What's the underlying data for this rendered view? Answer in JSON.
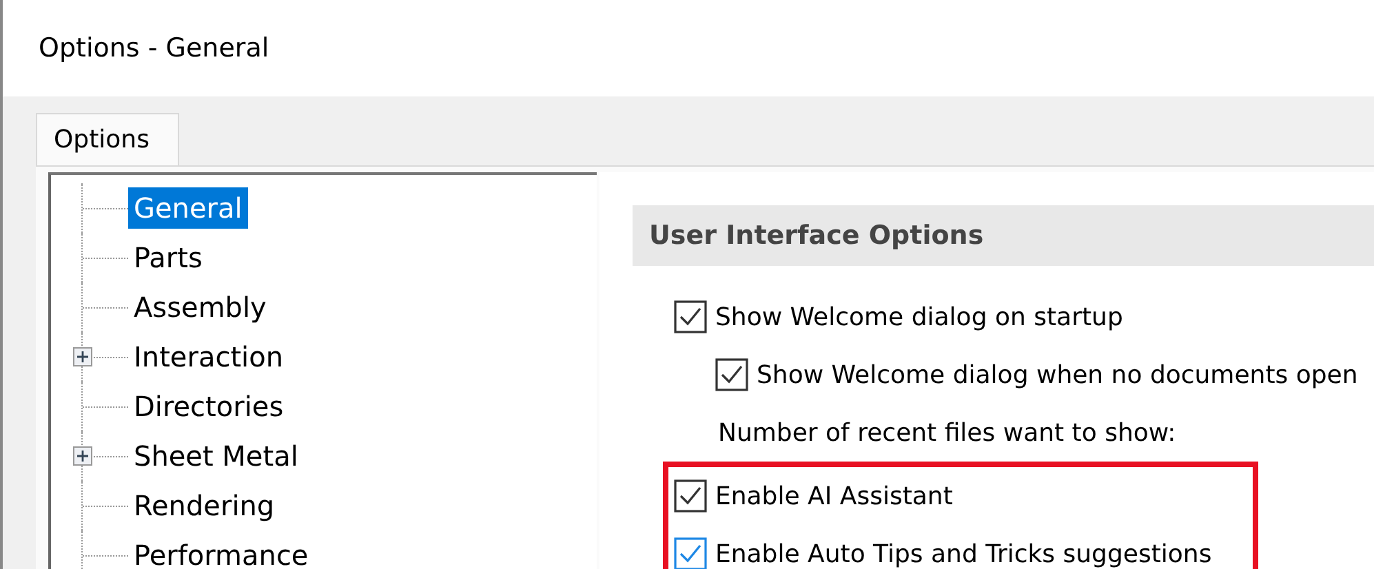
{
  "window": {
    "title": "Options - General"
  },
  "tabs": [
    {
      "label": "Options",
      "selected": true
    }
  ],
  "tree": {
    "items": [
      {
        "label": "General",
        "kind": "leaf",
        "selected": true
      },
      {
        "label": "Parts",
        "kind": "leaf",
        "selected": false
      },
      {
        "label": "Assembly",
        "kind": "leaf",
        "selected": false
      },
      {
        "label": "Interaction",
        "kind": "collapsed",
        "selected": false
      },
      {
        "label": "Directories",
        "kind": "leaf",
        "selected": false
      },
      {
        "label": "Sheet Metal",
        "kind": "collapsed",
        "selected": false
      },
      {
        "label": "Rendering",
        "kind": "leaf",
        "selected": false
      },
      {
        "label": "Performance",
        "kind": "leaf",
        "selected": false
      }
    ]
  },
  "section": {
    "title": "User Interface Options",
    "options": [
      {
        "kind": "checkbox",
        "label": "Show Welcome dialog on startup",
        "checked": true,
        "focused": false,
        "children": [
          {
            "kind": "checkbox",
            "label": "Show Welcome dialog when no documents open",
            "checked": true,
            "focused": false
          }
        ]
      },
      {
        "kind": "label",
        "label": "Number of recent files want to show:"
      }
    ],
    "highlighted_options": [
      {
        "kind": "checkbox",
        "label": "Enable AI Assistant",
        "checked": true,
        "focused": false
      },
      {
        "kind": "checkbox",
        "label": "Enable Auto Tips and Tricks suggestions",
        "checked": true,
        "focused": true
      }
    ]
  }
}
